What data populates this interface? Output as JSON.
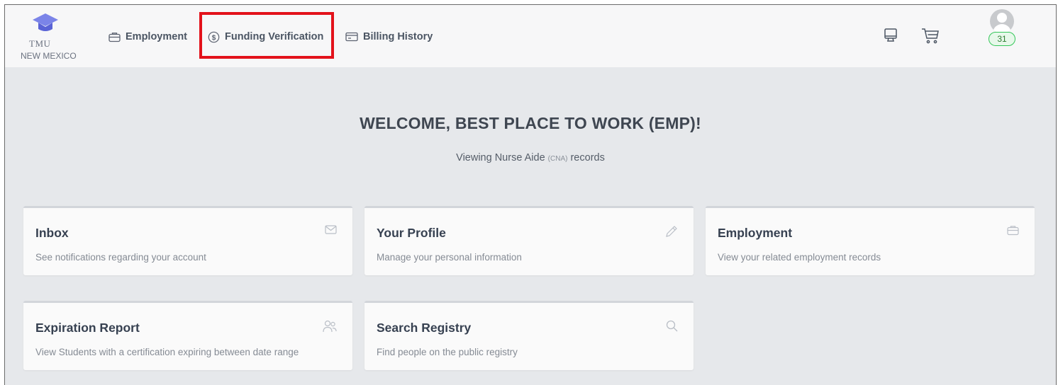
{
  "logo": {
    "name": "TMU",
    "sub": "NEW MEXICO"
  },
  "nav": {
    "employment": "Employment",
    "funding": "Funding Verification",
    "billing": "Billing History"
  },
  "header": {
    "badge_count": "31"
  },
  "welcome": {
    "title": "WELCOME, BEST PLACE TO WORK (EMP)!",
    "viewing_prefix": "Viewing Nurse Aide ",
    "viewing_code": "(CNA)",
    "viewing_suffix": " records"
  },
  "cards": [
    {
      "title": "Inbox",
      "desc": "See notifications regarding your account",
      "icon": "envelope-icon"
    },
    {
      "title": "Your Profile",
      "desc": "Manage your personal information",
      "icon": "pencil-icon"
    },
    {
      "title": "Employment",
      "desc": "View your related employment records",
      "icon": "briefcase-icon"
    },
    {
      "title": "Expiration Report",
      "desc": "View Students with a certification expiring between date range",
      "icon": "users-icon"
    },
    {
      "title": "Search Registry",
      "desc": "Find people on the public registry",
      "icon": "search-icon"
    }
  ],
  "colors": {
    "highlight": "#e3121b",
    "badge_border": "#34c759",
    "logo_cap": "#7b84e8"
  }
}
